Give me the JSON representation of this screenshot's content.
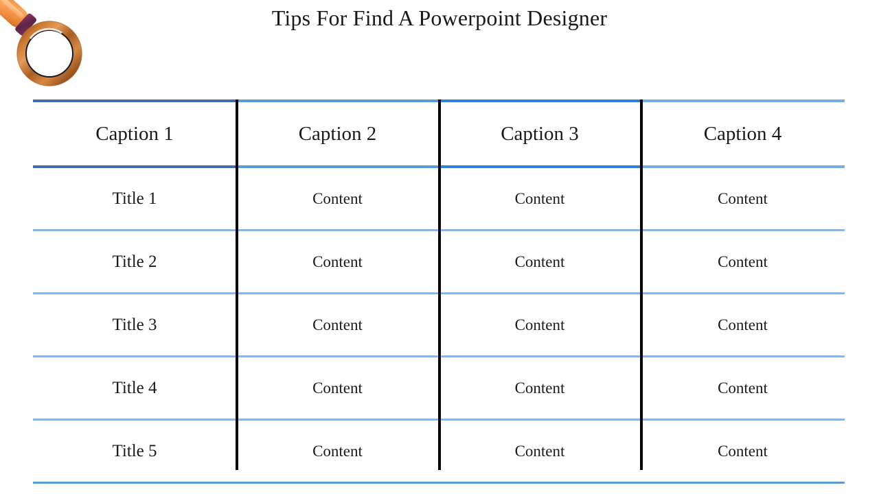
{
  "slide": {
    "title": "Tips For Find A Powerpoint Designer",
    "background_color": "#ffffff",
    "decoration_icon": "magnifying-glass-icon"
  },
  "colors": {
    "title_text": "#1a1a1a",
    "col1_rule": "#4a66ad",
    "col2_rule": "#5b9bd5",
    "col3_rule": "#2f80d8",
    "col4_rule": "#79aee2",
    "body_row_rule": "#8fb4e3",
    "vertical_divider": "#000000",
    "magnifier_handle": "#ef8a3c",
    "magnifier_ring": "#b5642a",
    "magnifier_ferrule": "#6b2c52"
  },
  "table": {
    "headers": [
      "Caption 1",
      "Caption 2",
      "Caption 3",
      "Caption 4"
    ],
    "rows": [
      [
        "Title 1",
        "Content",
        "Content",
        "Content"
      ],
      [
        "Title 2",
        "Content",
        "Content",
        "Content"
      ],
      [
        "Title 3",
        "Content",
        "Content",
        "Content"
      ],
      [
        "Title 4",
        "Content",
        "Content",
        "Content"
      ],
      [
        "Title 5",
        "Content",
        "Content",
        "Content"
      ]
    ]
  }
}
